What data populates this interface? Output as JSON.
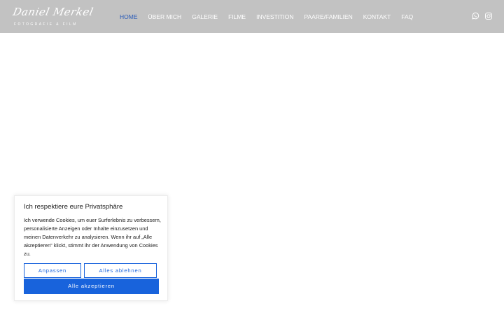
{
  "header": {
    "logo_script": "Daniel Merkel",
    "logo_subtitle": "FOTOGRAFIE & FILM",
    "background": "#c2c2c2",
    "nav": [
      {
        "label": "HOME",
        "active": true
      },
      {
        "label": "ÜBER MICH",
        "active": false
      },
      {
        "label": "GALERIE",
        "active": false
      },
      {
        "label": "FILME",
        "active": false
      },
      {
        "label": "INVESTITION",
        "active": false
      },
      {
        "label": "PAARE/FAMILIEN",
        "active": false
      },
      {
        "label": "KONTAKT",
        "active": false
      },
      {
        "label": "FAQ",
        "active": false
      }
    ],
    "social_icons": [
      "whatsapp-icon",
      "instagram-icon"
    ]
  },
  "cookie_banner": {
    "title": "Ich respektiere eure Privatsphäre",
    "text": "Ich verwende Cookies, um euer Surferlebnis zu verbessern, personalisierte Anzeigen oder Inhalte einzusetzen und meinen Datenverkehr zu analysieren. Wenn ihr auf „Alle akzeptieren“ klickt, stimmt ihr der Anwendung von Cookies zu.",
    "customize_label": "Anpassen",
    "reject_label": "Alles ablehnen",
    "accept_label": "Alle akzeptieren",
    "accent_color": "#1863dc"
  },
  "colors": {
    "nav_active": "#2a5bb8",
    "nav_default": "#ffffff"
  }
}
